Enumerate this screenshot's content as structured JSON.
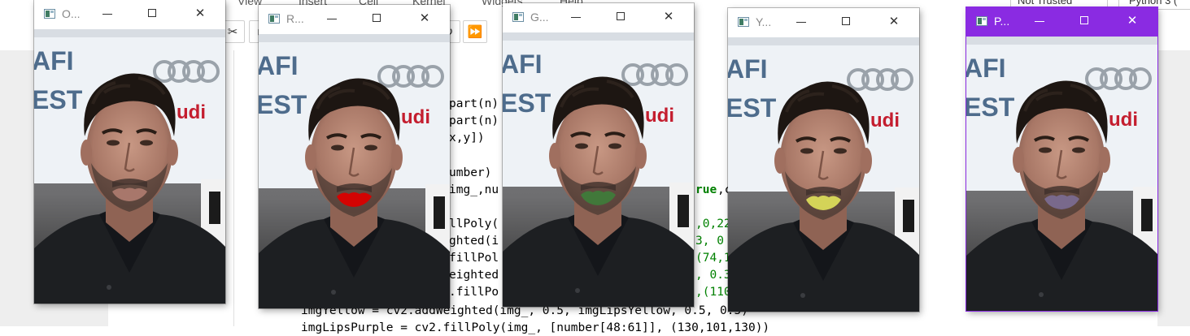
{
  "notebook": {
    "menu": [
      "View",
      "Insert",
      "Cell",
      "Kernel",
      "Widgets",
      "Help"
    ],
    "kernel_state": "Not Trusted",
    "kernel_name": "Python 3 (",
    "code_fragments": [
      {
        "text": "part(n)"
      },
      {
        "text": "part(n)"
      },
      {
        "text": "x,y])"
      },
      {
        "text": "umber)"
      },
      {
        "text": "img_,nu"
      },
      {
        "text": "rue",
        "style": "kw"
      },
      {
        "text": ",c"
      },
      {
        "text": "llPoly("
      },
      {
        "text": ",0,22",
        "style": "num"
      },
      {
        "text": "ghted(i"
      },
      {
        "text": "3, 0",
        "style": "num"
      },
      {
        "text": "fillPol"
      },
      {
        "text": "(74,1",
        "style": "num"
      },
      {
        "text": "eighted"
      },
      {
        "text": ", 0.3",
        "style": "num"
      },
      {
        "text": ".fillPo"
      },
      {
        "text": ",(110",
        "style": "num"
      },
      {
        "text": "imgYellow = cv2.addWeighted(img_, 0.5, imgLipsYellow, 0.5, 0.5)"
      },
      {
        "text": "imgLipsPurple = cv2.fillPoly(img_, [number[48:61]], (130,101,130))"
      }
    ]
  },
  "windows": [
    {
      "title": "O...",
      "lip_color": null
    },
    {
      "title": "R...",
      "lip_color": "#d90000"
    },
    {
      "title": "G...",
      "lip_color": "#3f7a3a"
    },
    {
      "title": "Y...",
      "lip_color": "#d9d95a"
    },
    {
      "title": "P...",
      "lip_color": "#7a6a90",
      "active": true
    }
  ],
  "colors": {
    "active_titlebar": "#8a2be2",
    "backdrop_banner": "#eef2f6",
    "banner_text_blue": "#4e6c8c",
    "banner_text_red": "#c41e2f"
  },
  "icons": [
    "window-app-icon",
    "minimize-icon",
    "maximize-icon",
    "close-icon",
    "cut-icon",
    "stop-icon",
    "fast-forward-icon"
  ]
}
